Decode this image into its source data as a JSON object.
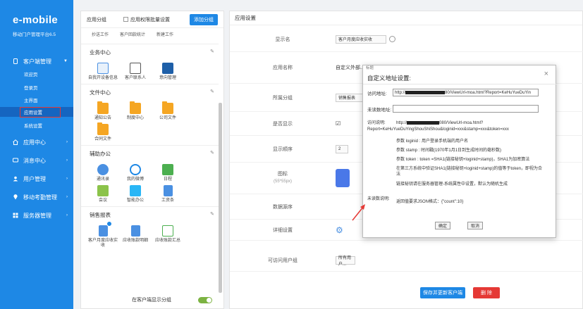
{
  "nav": {
    "title": "e-mobile",
    "subtitle": "移动门户管理平台6.5",
    "items": [
      {
        "label": "客户端管理",
        "expanded": true
      },
      {
        "label": "应用中心"
      },
      {
        "label": "消息中心"
      },
      {
        "label": "用户管理"
      },
      {
        "label": "移动考勤管理"
      },
      {
        "label": "服务器管理"
      }
    ],
    "sub_items": [
      "欢迎页",
      "登录页",
      "主界面",
      "应用设置",
      "系统设置"
    ],
    "active_sub": "应用设置"
  },
  "app_group_panel": {
    "title": "应用分组",
    "batch_checkbox_label": "应用权限批量设置",
    "add_button": "添加分组",
    "top_apps": [
      "抄送工作",
      "客户回款统计",
      "新建工作"
    ],
    "groups": [
      {
        "name": "业务中心",
        "apps": [
          "自我开设备信息",
          "客户联系人",
          "意向管理"
        ]
      },
      {
        "name": "文件中心",
        "apps": [
          "通知公告",
          "制度中心",
          "公司文件",
          "合同文件"
        ]
      },
      {
        "name": "辅助办公",
        "apps": [
          "通讯录",
          "我的微博",
          "日程",
          "会议",
          "智能办公",
          "工资条"
        ]
      },
      {
        "name": "销售报表",
        "apps": [
          "客户月度应收实收",
          "应收账款明细",
          "应收账款汇总"
        ]
      }
    ],
    "footer_label": "在客户端显示分组",
    "footer_toggle_on": true
  },
  "settings": {
    "title": "应用设置",
    "rows": {
      "display_name_label": "显示名",
      "display_name_value": "客户月度应收实收",
      "app_name_label": "应用名称",
      "app_name_value": "自定义外部...",
      "group_label": "所属分组",
      "group_value": "销售报表",
      "is_shown_label": "是否显示",
      "order_label": "显示顺序",
      "order_value": "2",
      "icon_label": "图标",
      "icon_hint": "(55*55px)",
      "source_label": "数据源序",
      "detail_label": "详细设置",
      "visible_users_label": "可访问用户组",
      "visible_users_value": "所有用户..."
    },
    "save_button": "保存并更新客户端",
    "delete_button": "删 除"
  },
  "modal": {
    "mini_title": "标题",
    "title": "自定义地址设置:",
    "close": "×",
    "url_label": "访问地址:",
    "url_prefix": "http://",
    "url_suffix": "80/ViewUrl-moa.html?Report=KeHuYueDuYin",
    "unread_label": "未读数地址:",
    "desc_label": "访问说明:",
    "desc_url_suffix": "080/ViewUrl-moa.html?",
    "desc_url_line2": "Report=KeHuYueDuYingShouShiShou&loginid=xxx&stamp=xxx&token=xxx",
    "params": [
      "参数 loginid : 用户登录手机端的用户名",
      "参数 stamp : 时间戳(1970年1月1日到生成时间的毫秒数)",
      "参数 token : token =SHA1(链接秘钥+loginid+stamp)，SHA1为加密算法",
      "在第三方系统中验证SHA1(链接秘钥+loginid+stamp)的值等于token，即视为合",
      "法",
      "链接秘钥请在服务器管理-系统属性中设置，默认为随机生成"
    ],
    "unread_desc_label": "未读数说明:",
    "unread_desc": "返回值要求JSON格式：{\"count\":10}",
    "ok": "确定",
    "cancel": "取消"
  },
  "colors": {
    "accent": "#1e88e5",
    "danger": "#e53935",
    "folder": "#f5a623"
  }
}
